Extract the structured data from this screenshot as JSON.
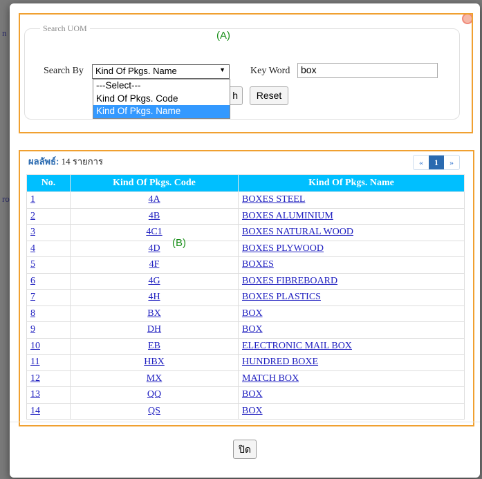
{
  "background": {
    "fragment1": "n",
    "fragment2": "ro"
  },
  "annotations": {
    "a": "(A)",
    "b": "(B)"
  },
  "search": {
    "legend": "Search UOM",
    "search_by_label": "Search By",
    "selected": "Kind Of Pkgs. Name",
    "options": [
      "---Select---",
      "Kind Of Pkgs. Code",
      "Kind Of Pkgs. Name"
    ],
    "keyword_label": "Key Word",
    "keyword_value": "box",
    "search_button_partial": "h",
    "reset_button": "Reset"
  },
  "results": {
    "label": "ผลลัพธ์:",
    "count_text": "14 รายการ",
    "pager": {
      "prev": "«",
      "current": "1",
      "next": "»"
    },
    "columns": [
      "No.",
      "Kind Of Pkgs. Code",
      "Kind Of Pkgs. Name"
    ],
    "rows": [
      {
        "no": "1",
        "code": "4A",
        "name": "BOXES STEEL"
      },
      {
        "no": "2",
        "code": "4B",
        "name": "BOXES ALUMINIUM"
      },
      {
        "no": "3",
        "code": "4C1",
        "name": "BOXES NATURAL WOOD"
      },
      {
        "no": "4",
        "code": "4D",
        "name": "BOXES PLYWOOD"
      },
      {
        "no": "5",
        "code": "4F",
        "name": "BOXES"
      },
      {
        "no": "6",
        "code": "4G",
        "name": "BOXES FIBREBOARD"
      },
      {
        "no": "7",
        "code": "4H",
        "name": "BOXES PLASTICS"
      },
      {
        "no": "8",
        "code": "BX",
        "name": "BOX"
      },
      {
        "no": "9",
        "code": "DH",
        "name": "BOX"
      },
      {
        "no": "10",
        "code": "EB",
        "name": "ELECTRONIC MAIL BOX"
      },
      {
        "no": "11",
        "code": "HBX",
        "name": "HUNDRED BOXE"
      },
      {
        "no": "12",
        "code": "MX",
        "name": "MATCH BOX"
      },
      {
        "no": "13",
        "code": "QQ",
        "name": "BOX"
      },
      {
        "no": "14",
        "code": "QS",
        "name": "BOX"
      }
    ]
  },
  "footer": {
    "close_button": "ปิด"
  },
  "colors": {
    "annotation_border": "#f0a030",
    "table_header": "#00bfff",
    "selected_option": "#3399ff"
  }
}
